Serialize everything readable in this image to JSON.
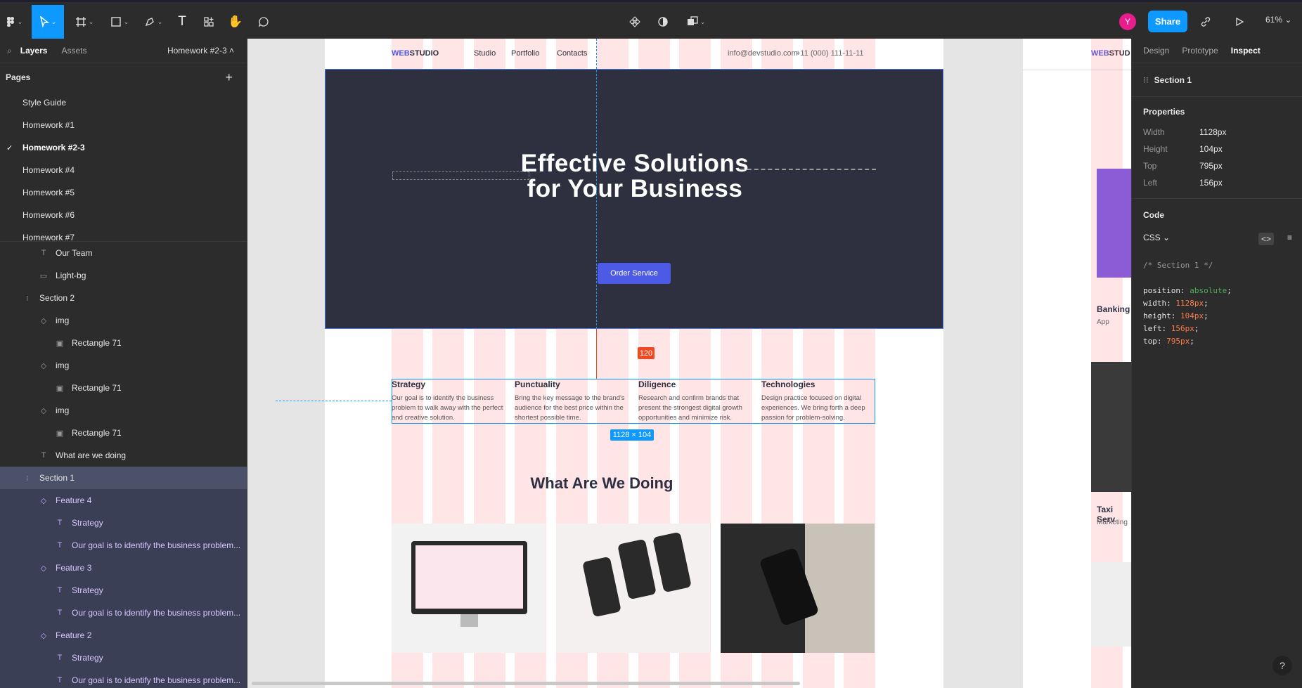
{
  "toolbar": {
    "share": "Share",
    "avatar": "Y",
    "zoom": "61%"
  },
  "left": {
    "tabs": {
      "layers": "Layers",
      "assets": "Assets"
    },
    "page_name": "Homework #2-3",
    "pages_title": "Pages",
    "pages": [
      "Style Guide",
      "Homework #1",
      "Homework #2-3",
      "Homework #4",
      "Homework #5",
      "Homework #6",
      "Homework #7"
    ],
    "layers": [
      {
        "label": "Our Team",
        "icon": "T"
      },
      {
        "label": "Light-bg",
        "icon": "▭"
      },
      {
        "label": "Section 2",
        "icon": "⁝"
      },
      {
        "label": "img",
        "icon": "◇"
      },
      {
        "label": "Rectangle 71",
        "icon": "▣"
      },
      {
        "label": "img",
        "icon": "◇"
      },
      {
        "label": "Rectangle 71",
        "icon": "▣"
      },
      {
        "label": "img",
        "icon": "◇"
      },
      {
        "label": "Rectangle 71",
        "icon": "▣"
      },
      {
        "label": "What are we doing",
        "icon": "T"
      },
      {
        "label": "Section 1",
        "icon": "⁝"
      },
      {
        "label": "Feature 4",
        "icon": "◇"
      },
      {
        "label": "Strategy",
        "icon": "T"
      },
      {
        "label": "Our goal is to identify the business problem...",
        "icon": "T"
      },
      {
        "label": "Feature 3",
        "icon": "◇"
      },
      {
        "label": "Strategy",
        "icon": "T"
      },
      {
        "label": "Our goal is to identify the business problem...",
        "icon": "T"
      },
      {
        "label": "Feature 2",
        "icon": "◇"
      },
      {
        "label": "Strategy",
        "icon": "T"
      },
      {
        "label": "Our goal is to identify the business problem...",
        "icon": "T"
      }
    ]
  },
  "right": {
    "tabs": {
      "design": "Design",
      "prototype": "Prototype",
      "inspect": "Inspect"
    },
    "selection": "Section 1",
    "properties_title": "Properties",
    "props": [
      {
        "k": "Width",
        "v": "1128px"
      },
      {
        "k": "Height",
        "v": "104px"
      },
      {
        "k": "Top",
        "v": "795px"
      },
      {
        "k": "Left",
        "v": "156px"
      }
    ],
    "code_title": "Code",
    "code_lang": "CSS",
    "code": {
      "comment": "/* Section 1 */",
      "lines": [
        {
          "p": "position: ",
          "v": "absolute",
          "g": true
        },
        {
          "p": "width: ",
          "v": "1128px"
        },
        {
          "p": "height: ",
          "v": "104px"
        },
        {
          "p": "left: ",
          "v": "156px"
        },
        {
          "p": "top: ",
          "v": "795px"
        }
      ]
    }
  },
  "site": {
    "logo_a": "WEB",
    "logo_b": "STUDIO",
    "nav": [
      "Studio",
      "Portfolio",
      "Contacts"
    ],
    "email": "info@devstudio.com",
    "phone": "+11 (000) 111-11-11",
    "hero_line1": "Effective Solutions",
    "hero_line2": "for Your Business",
    "order_btn": "Order Service",
    "spacing_badge": "120",
    "size_badge": "1128 × 104",
    "features": [
      {
        "title": "Strategy",
        "text": "Our goal is to identify the business problem to walk away with the perfect and creative solution."
      },
      {
        "title": "Punctuality",
        "text": "Bring the key message to the brand's audience for the best price within the shortest possible time."
      },
      {
        "title": "Diligence",
        "text": "Research and confirm brands that present the strongest digital growth opportunities and minimize risk."
      },
      {
        "title": "Technologies",
        "text": "Design practice focused on digital experiences. We bring forth a deep passion for problem-solving."
      }
    ],
    "what_title": "What Are We Doing",
    "side": {
      "logo_a": "WEB",
      "logo_b": "STUD",
      "card1": "Banking",
      "card1_sub": "App",
      "card2": "Taxi Serv",
      "card2_sub": "Marketing"
    }
  }
}
